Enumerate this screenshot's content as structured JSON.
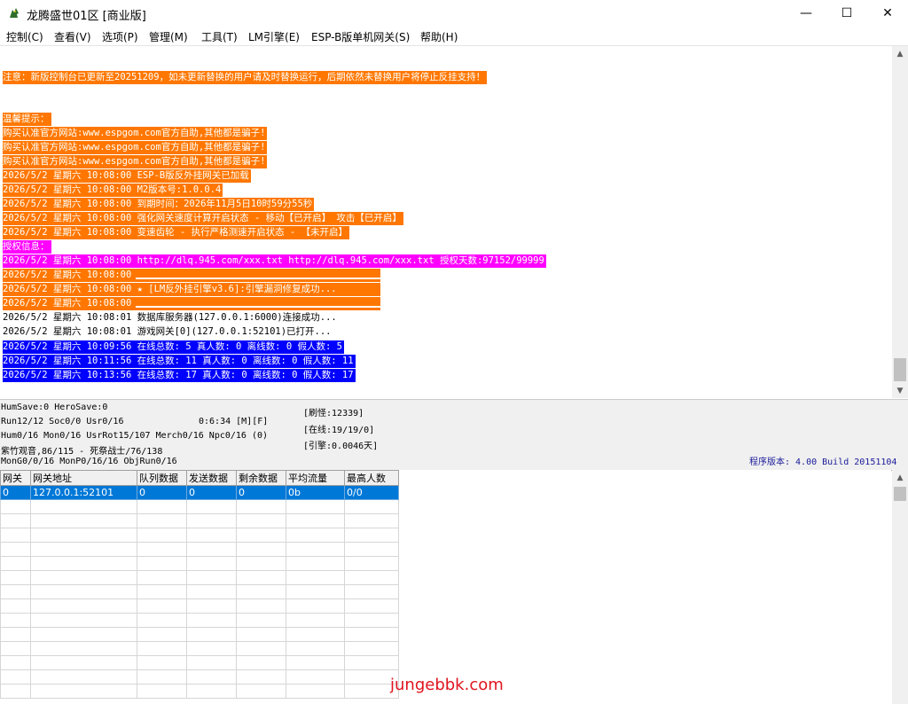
{
  "window": {
    "title": "龙腾盛世01区 [商业版]",
    "minimize_glyph": "—",
    "maximize_glyph": "☐",
    "close_glyph": "✕"
  },
  "menu": [
    "控制(C)",
    "查看(V)",
    "选项(P)",
    "管理(M)",
    "工具(T)",
    "LM引擎(E)",
    "ESP-B版单机网关(S)",
    "帮助(H)"
  ],
  "log": [
    {
      "text": "注意：新版控制台已更新至20251209，如未更新替换的用户请及时替换运行，后期依然未替换用户将停止反挂支持！",
      "color": "orange"
    },
    {
      "text": "温馨提示：",
      "color": "orange"
    },
    {
      "text": "购买认准官方网站:www.espgom.com官方自助,其他都是骗子!",
      "color": "orange"
    },
    {
      "text": "购买认准官方网站:www.espgom.com官方自助,其他都是骗子!",
      "color": "orange"
    },
    {
      "text": "购买认准官方网站:www.espgom.com官方自助,其他都是骗子!",
      "color": "orange"
    },
    {
      "text": "2026/5/2 星期六 10:08:00 ESP-B版反外挂网关已加载",
      "color": "orange"
    },
    {
      "text": "2026/5/2 星期六 10:08:00 M2版本号:1.0.0.4",
      "color": "orange"
    },
    {
      "text": "2026/5/2 星期六 10:08:00 到期时间：2026年11月5日10时59分55秒",
      "color": "orange"
    },
    {
      "text": "2026/5/2 星期六 10:08:00 强化网关速度计算开启状态 - 移动【已开启】 攻击【已开启】",
      "color": "orange"
    },
    {
      "text": "2026/5/2 星期六 10:08:00 变速齿轮 - 执行严格测速开启状态 - 【未开启】",
      "color": "orange"
    },
    {
      "text": "授权信息：",
      "color": "magenta"
    },
    {
      "text": "2026/5/2 星期六 10:08:00 http://dlq.945.com/xxx.txt http://dlq.945.com/xxx.txt 授权天数:97152/99999",
      "color": "magenta"
    },
    {
      "text": "2026/5/2 星期六 10:08:00 ",
      "color": "orange",
      "rule": true
    },
    {
      "text": "2026/5/2 星期六 10:08:00 ★ [LM反外挂引擎v3.6]:引擎漏洞修复成功...",
      "color": "orange"
    },
    {
      "text": "2026/5/2 星期六 10:08:00 ",
      "color": "orange",
      "rule": true
    },
    {
      "text": "2026/5/2 星期六 10:08:01 数据库服务器(127.0.0.1:6000)连接成功...",
      "color": "plain"
    },
    {
      "text": "2026/5/2 星期六 10:08:01 游戏网关[0](127.0.0.1:52101)已打开...",
      "color": "plain"
    },
    {
      "text": "2026/5/2 星期六 10:09:56 在线总数: 5 真人数: 0 离线数: 0 假人数: 5",
      "color": "blue"
    },
    {
      "text": "2026/5/2 星期六 10:11:56 在线总数: 11 真人数: 0 离线数: 0 假人数: 11",
      "color": "blue"
    },
    {
      "text": "2026/5/2 星期六 10:13:56 在线总数: 17 真人数: 0 离线数: 0 假人数: 17",
      "color": "blue"
    }
  ],
  "colors": {
    "orange": "#ff7700",
    "magenta": "#ff00ff",
    "blue": "#0000ff",
    "selection": "#0078d7"
  },
  "status": {
    "line1": "HumSave:0 HeroSave:0",
    "line2": "Run12/12 Soc0/0 Usr0/16",
    "time": "0:6:34 [M][F]",
    "line3": "Hum0/16 Mon0/16 UsrRot15/107 Merch0/16 Npc0/16 (0)",
    "line4": "紫竹观音,86/115 - 死祭战士/76/138",
    "line5": "MonG0/0/16 MonP0/16/16 ObjRun0/16",
    "refresh": "[刷怪:12339]",
    "online": "[在线:19/19/0]",
    "engine": "[引擎:0.0046天]",
    "version": "程序版本: 4.00 Build 20151104"
  },
  "gateway_table": {
    "headers": [
      "网关",
      "网关地址",
      "队列数据",
      "发送数据",
      "剩余数据",
      "平均流量",
      "最高人数"
    ],
    "rows": [
      [
        "0",
        "127.0.0.1:52101",
        "0",
        "0",
        "0",
        "0b",
        "0/0"
      ]
    ]
  },
  "watermark": "jungebbk.com"
}
